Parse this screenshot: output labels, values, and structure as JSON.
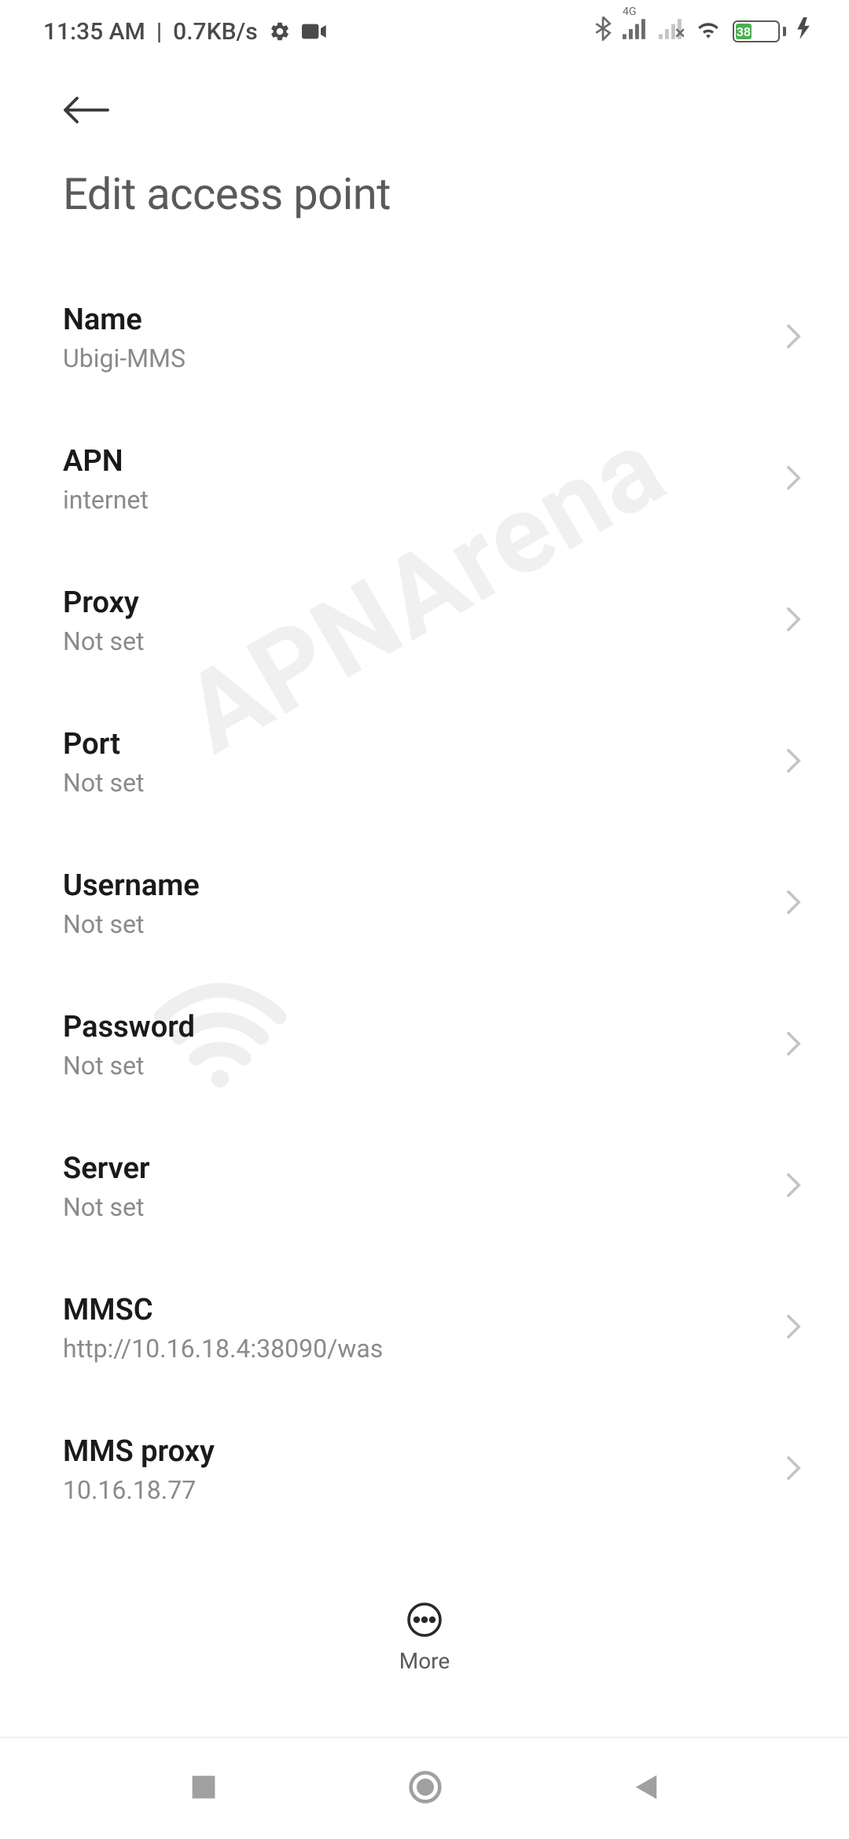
{
  "status_bar": {
    "time": "11:35 AM",
    "data_rate": "0.7KB/s",
    "network_label": "4G",
    "battery_percent": "38"
  },
  "page_title": "Edit access point",
  "settings": [
    {
      "label": "Name",
      "value": "Ubigi-MMS"
    },
    {
      "label": "APN",
      "value": "internet"
    },
    {
      "label": "Proxy",
      "value": "Not set"
    },
    {
      "label": "Port",
      "value": "Not set"
    },
    {
      "label": "Username",
      "value": "Not set"
    },
    {
      "label": "Password",
      "value": "Not set"
    },
    {
      "label": "Server",
      "value": "Not set"
    },
    {
      "label": "MMSC",
      "value": "http://10.16.18.4:38090/was"
    },
    {
      "label": "MMS proxy",
      "value": "10.16.18.77"
    }
  ],
  "bottom": {
    "more_label": "More"
  },
  "watermark_text": "APNArena"
}
